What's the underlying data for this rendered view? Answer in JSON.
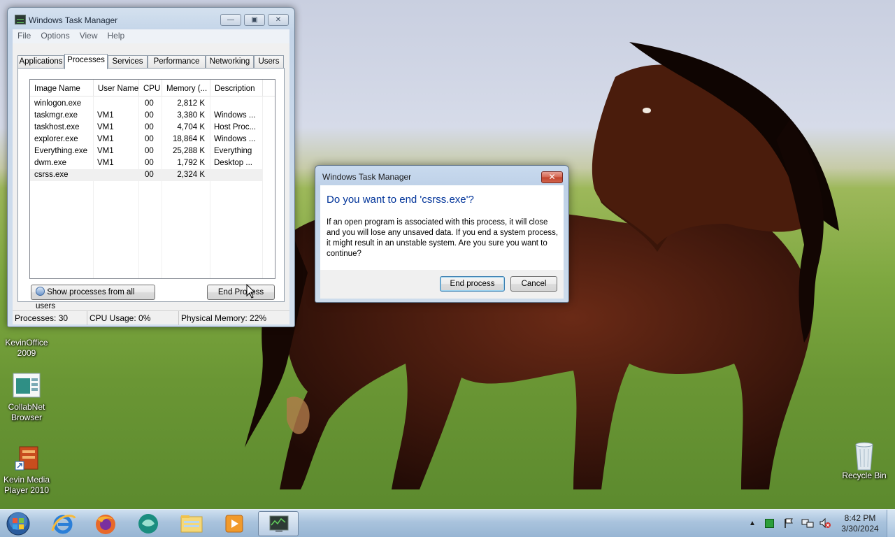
{
  "desktop": {
    "icons": [
      {
        "name": "KevinOffice 2009",
        "line1": "KevinOffice",
        "line2": "2009"
      },
      {
        "name": "CollabNet Browser",
        "line1": "CollabNet",
        "line2": "Browser"
      },
      {
        "name": "Kevin Media Player 2010",
        "line1": "Kevin Media",
        "line2": "Player 2010"
      },
      {
        "name": "Recycle Bin",
        "line1": "Recycle Bin",
        "line2": ""
      }
    ]
  },
  "taskmanager": {
    "title": "Windows Task Manager",
    "menu": [
      "File",
      "Options",
      "View",
      "Help"
    ],
    "tabs": [
      "Applications",
      "Processes",
      "Services",
      "Performance",
      "Networking",
      "Users"
    ],
    "active_tab": "Processes",
    "columns": [
      "Image Name",
      "User Name",
      "CPU",
      "Memory (...",
      "Description"
    ],
    "rows": [
      {
        "image": "winlogon.exe",
        "user": "",
        "cpu": "00",
        "memory": "2,812 K",
        "desc": ""
      },
      {
        "image": "taskmgr.exe",
        "user": "VM1",
        "cpu": "00",
        "memory": "3,380 K",
        "desc": "Windows ..."
      },
      {
        "image": "taskhost.exe",
        "user": "VM1",
        "cpu": "00",
        "memory": "4,704 K",
        "desc": "Host Proc..."
      },
      {
        "image": "explorer.exe",
        "user": "VM1",
        "cpu": "00",
        "memory": "18,864 K",
        "desc": "Windows ..."
      },
      {
        "image": "Everything.exe",
        "user": "VM1",
        "cpu": "00",
        "memory": "25,288 K",
        "desc": "Everything"
      },
      {
        "image": "dwm.exe",
        "user": "VM1",
        "cpu": "00",
        "memory": "1,792 K",
        "desc": "Desktop ..."
      },
      {
        "image": "csrss.exe",
        "user": "",
        "cpu": "00",
        "memory": "2,324 K",
        "desc": "",
        "selected": true
      }
    ],
    "show_all_label": "Show processes from all users",
    "end_process_label": "End Process",
    "status": {
      "processes": "Processes: 30",
      "cpu": "CPU Usage: 0%",
      "memory": "Physical Memory: 22%"
    }
  },
  "dialog": {
    "title": "Windows Task Manager",
    "heading": "Do you want to end 'csrss.exe'?",
    "message": "If an open program is associated with this process, it will close and you will lose any unsaved data. If you end a system process, it might result in an unstable system. Are you sure you want to continue?",
    "confirm_label": "End process",
    "cancel_label": "Cancel"
  },
  "taskbar": {
    "pinned": [
      "start-orb",
      "internet-explorer",
      "firefox",
      "bing-browser",
      "windows-explorer",
      "media-player",
      "task-manager"
    ],
    "clock_time": "8:42 PM",
    "clock_date": "3/30/2024"
  },
  "colors": {
    "dialog_heading": "#003399",
    "close_button": "#c2432c",
    "taskbar": "#a9c3dd"
  }
}
